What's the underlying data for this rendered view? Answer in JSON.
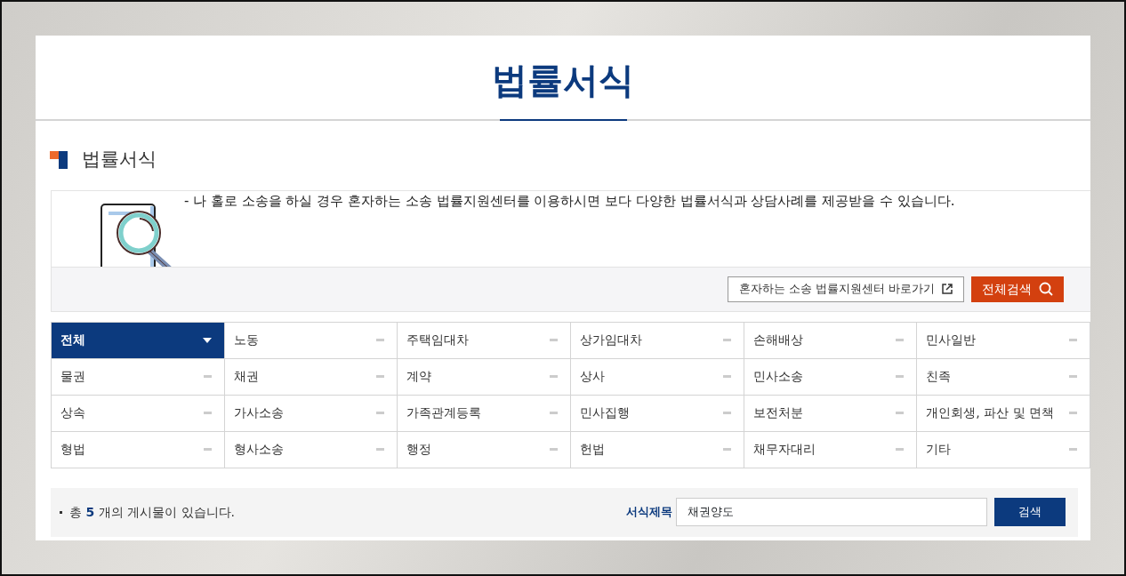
{
  "page_title": "법률서식",
  "section_title": "법률서식",
  "intro": {
    "text": "- 나 홀로 소송을 하실 경우 혼자하는 소송 법률지원센터를 이용하시면 보다 다양한 법률서식과 상담사례를 제공받을 수 있습니다.",
    "link_button": "혼자하는 소송 법률지원센터 바로가기",
    "search_button": "전체검색"
  },
  "categories": [
    {
      "label": "전체",
      "selected": true
    },
    {
      "label": "노동",
      "selected": false
    },
    {
      "label": "주택임대차",
      "selected": false
    },
    {
      "label": "상가임대차",
      "selected": false
    },
    {
      "label": "손해배상",
      "selected": false
    },
    {
      "label": "민사일반",
      "selected": false
    },
    {
      "label": "물권",
      "selected": false
    },
    {
      "label": "채권",
      "selected": false
    },
    {
      "label": "계약",
      "selected": false
    },
    {
      "label": "상사",
      "selected": false
    },
    {
      "label": "민사소송",
      "selected": false
    },
    {
      "label": "친족",
      "selected": false
    },
    {
      "label": "상속",
      "selected": false
    },
    {
      "label": "가사소송",
      "selected": false
    },
    {
      "label": "가족관계등록",
      "selected": false
    },
    {
      "label": "민사집행",
      "selected": false
    },
    {
      "label": "보전처분",
      "selected": false
    },
    {
      "label": "개인회생, 파산 및 면책",
      "selected": false
    },
    {
      "label": "형법",
      "selected": false
    },
    {
      "label": "형사소송",
      "selected": false
    },
    {
      "label": "행정",
      "selected": false
    },
    {
      "label": "헌법",
      "selected": false
    },
    {
      "label": "채무자대리",
      "selected": false
    },
    {
      "label": "기타",
      "selected": false
    }
  ],
  "result_count": "총 **5** 개의 게시물이 있습니다.",
  "search": {
    "label": "서식제목",
    "value": "채권양도",
    "button": "검색"
  }
}
